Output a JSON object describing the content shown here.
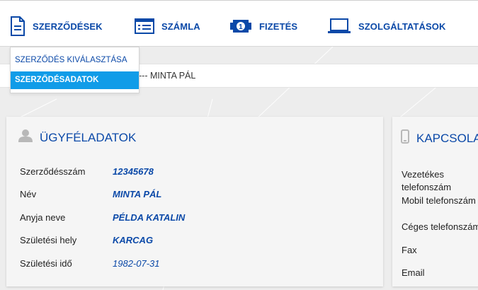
{
  "nav": {
    "items": [
      {
        "label": "SZERZŐDÉSEK",
        "icon": "document-icon"
      },
      {
        "label": "SZÁMLA",
        "icon": "invoice-list-icon"
      },
      {
        "label": "FIZETÉS",
        "icon": "payment-coin-icon"
      },
      {
        "label": "SZOLGÁLTATÁSOK",
        "icon": "laptop-icon"
      }
    ],
    "dropdown": [
      {
        "label": "SZERZŐDÉS KIVÁLASZTÁSA"
      },
      {
        "label": "SZERZŐDÉSADATOK",
        "active": true
      }
    ]
  },
  "breadcrumb": {
    "text": "--- MINTA PÁL"
  },
  "client_card": {
    "title": "ÜGYFÉLADATOK",
    "icon": "user-icon",
    "rows": [
      {
        "label": "Szerződésszám",
        "value": "12345678"
      },
      {
        "label": "Név",
        "value": "MINTA PÁL"
      },
      {
        "label": "Anyja neve",
        "value": "PÉLDA KATALIN"
      },
      {
        "label": "Születési hely",
        "value": "KARCAG"
      },
      {
        "label": "Születési idő",
        "value": "1982-07-31"
      }
    ]
  },
  "contact_card": {
    "title": "KAPCSOLA",
    "icon": "mobile-phone-icon",
    "rows": [
      {
        "label": "Vezetékes telefonszám"
      },
      {
        "label": "Mobil telefonszám"
      },
      {
        "label": "Céges telefonszám"
      },
      {
        "label": "Fax"
      },
      {
        "label": "Email"
      }
    ]
  },
  "colors": {
    "accent": "#0b49a8",
    "active_bg": "#109ce8",
    "background": "#ededed"
  }
}
